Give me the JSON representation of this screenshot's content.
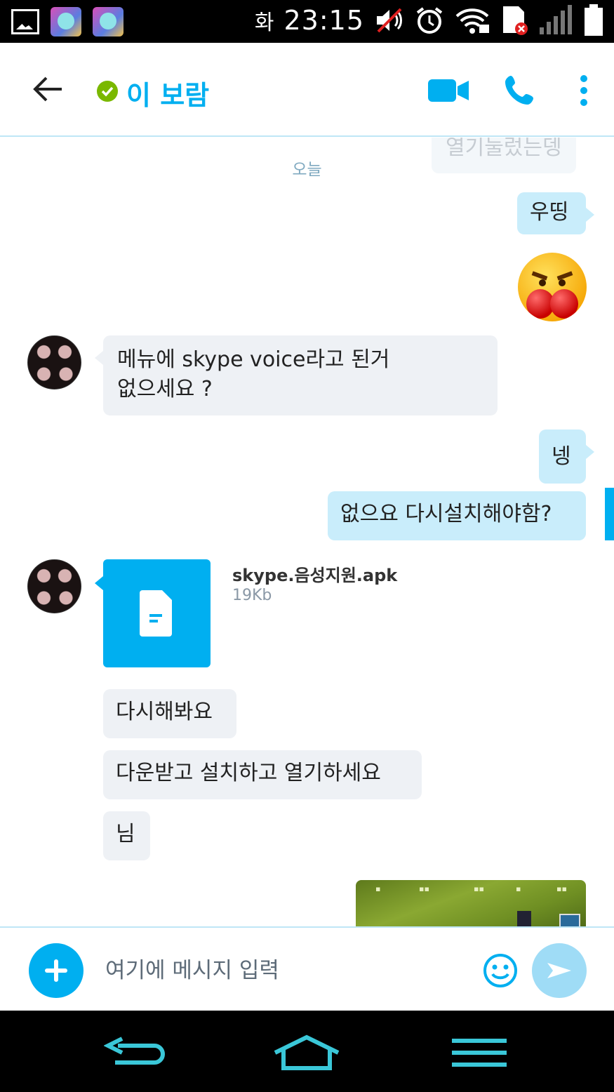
{
  "status_bar": {
    "day": "화",
    "time": "23:15"
  },
  "header": {
    "contact_name": "이 보람",
    "presence": "online",
    "accent_color": "#00aff0"
  },
  "chat": {
    "date_separator": "오늘",
    "messages": [
      {
        "id": "m0",
        "direction": "out",
        "text": "열기눌렀는뎅",
        "faded": true
      },
      {
        "id": "m1",
        "direction": "out",
        "text": "우띵"
      },
      {
        "id": "m2",
        "direction": "out",
        "type": "emoticon",
        "icon": "angry-boxing-emoticon"
      },
      {
        "id": "m3",
        "direction": "in",
        "line1": "메뉴에  skype voice라고 된거",
        "line2": "없으세요 ?"
      },
      {
        "id": "m4",
        "direction": "out",
        "text": "넹"
      },
      {
        "id": "m5",
        "direction": "out",
        "text": "없으요 다시설치해야함?"
      },
      {
        "id": "m6",
        "direction": "in",
        "type": "file",
        "file_name": "skype.음성지원.apk",
        "file_size": "19Kb"
      },
      {
        "id": "m7",
        "direction": "in",
        "text": "다시해봐요"
      },
      {
        "id": "m8",
        "direction": "in",
        "text": "다운받고 설치하고 열기하세요"
      },
      {
        "id": "m9",
        "direction": "in",
        "text": "님"
      },
      {
        "id": "m10",
        "direction": "out",
        "type": "image"
      }
    ]
  },
  "input_bar": {
    "placeholder": "여기에 메시지 입력"
  }
}
